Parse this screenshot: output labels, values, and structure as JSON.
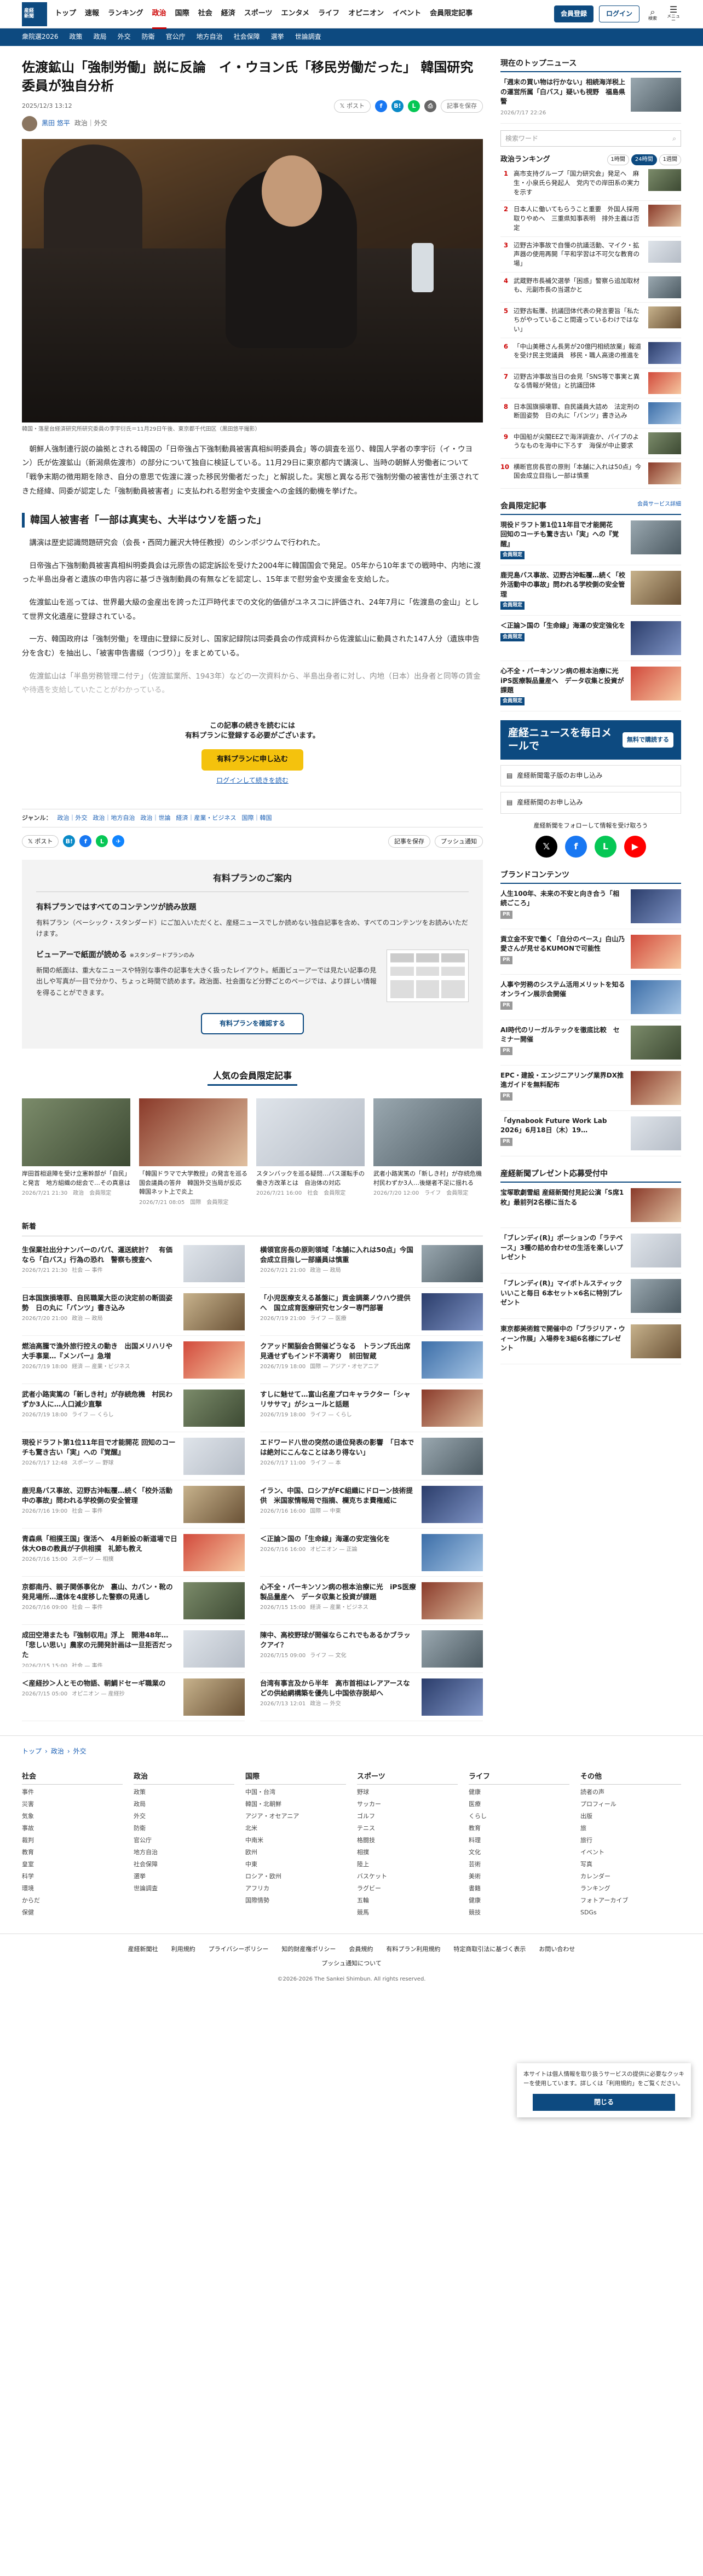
{
  "logo": {
    "line1": "産経",
    "line2": "新聞",
    "en": "THE SANKEI SHIMBUN"
  },
  "gnav": [
    "トップ",
    "速報",
    "ランキング",
    "政治",
    "国際",
    "社会",
    "経済",
    "スポーツ",
    "エンタメ",
    "ライフ",
    "オピニオン",
    "イベント",
    "会員限定記事"
  ],
  "gnav_current": "政治",
  "header": {
    "member": "会員登録",
    "login": "ログイン",
    "search": "検索",
    "menu": "メニュー"
  },
  "subnav": [
    "衆院選2026",
    "政策",
    "政局",
    "外交",
    "防衛",
    "官公庁",
    "地方自治",
    "社会保障",
    "選挙",
    "世論調査"
  ],
  "article": {
    "title": "佐渡鉱山「強制労働」説に反論　イ・ウヨン氏「移民労働だった」 韓国研究委員が独自分析",
    "date": "2025/12/3 13:12",
    "author": "黒田 悠平",
    "section": "政治｜外交",
    "share": {
      "post": "ポスト",
      "bookmark": "記事を保存",
      "print": "印刷"
    },
    "caption": "韓国・落星台経済研究所研究委員の李宇衍氏＝11月29日午後、東京都千代田区（黒田悠平撮影）",
    "p1": "朝鮮人強制連行説の論拠とされる韓国の「日帝強占下強制動員被害真相糾明委員会」等の調査を巡り、韓国人学者の李宇衍（イ・ウヨン）氏が佐渡鉱山（新潟県佐渡市）の部分について独自に検証している。11月29日に東京都内で講演し、当時の朝鮮人労働者について「戦争末期の徴用期を除き、自分の意思で佐渡に渡った移民労働者だった」と解説した。実態と異なる形で強制労働の被害性が主張されてきた経緯、同委が認定した「強制動員被害者」に支払われる慰労金や支援金への金銭的動機を挙げた。",
    "h2": "韓国人被害者「一部は真実も、大半はウソを語った」",
    "p2": "講演は歴史認識問題研究会（会長・西岡力麗沢大特任教授）のシンポジウムで行われた。",
    "p3": "日帝強占下強制動員被害真相糾明委員会は元原告の認定訴訟を受けた2004年に韓国国会で発足。05年から10年までの戦時中、内地に渡った半島出身者と遺族の申告内容に基づき強制動員の有無などを認定し、15年まで慰労金や支援金を支給した。",
    "p4": "佐渡鉱山を巡っては、世界最大級の金産出を誇った江戸時代までの文化的価値がユネスコに評価され、24年7月に「佐渡島の金山」として世界文化遺産に登録されている。",
    "p5": "一方、韓国政府は「強制労働」を理由に登録に反対し、国家記録院は同委員会の作成資料から佐渡鉱山に動員された147人分（遺族申告分を含む）を抽出し、「被害申告書綴（つづり）」をまとめている。",
    "p6": "佐渡鉱山は「半島労務管理ニ付テ」（佐渡鉱業所、1943年）などの一次資料から、半島出身者に対し、内地（日本）出身者と同等の賃金や待遇を支給していたことがわかっている。"
  },
  "paywall": {
    "t1": "この記事の続きを読むには",
    "t2": "有料プランに登録する必要がございます。",
    "btn": "有料プランに申し込む",
    "login": "ログインして続きを読む"
  },
  "tags": {
    "label": "ジャンル：",
    "items": [
      "政治｜外交",
      "政治｜地方自治",
      "政治｜世論",
      "経済｜産業・ビジネス",
      "国際｜韓国"
    ]
  },
  "share2": {
    "post": "ポスト",
    "bookmark": "記事を保存",
    "push": "プッシュ通知"
  },
  "plan": {
    "head": "有料プランのご案内",
    "h1": "有料プランではすべてのコンテンツが読み放題",
    "p1": "有料プラン（ベーシック・スタンダード）にご加入いただくと、産経ニュースでしか読めない独自記事を含め、すべてのコンテンツをお読みいただけます。",
    "h2": "ビューアーで紙面が読める",
    "h2s": "※スタンダードプランのみ",
    "p2": "新聞の紙面は、重大なニュースや特別な事件の記事を大きく扱ったレイアウト。紙面ビューアーでは見たい記事の見出しや写真が一目で分かり、ちょっと時間で読めます。政治面、社会面など分野ごとのページでは、より詳しい情報を得ることができます。",
    "btn": "有料プランを確認する"
  },
  "popular": {
    "title": "人気の会員限定記事",
    "items": [
      {
        "t": "岸田首相退陣を受け立憲幹部が「自民」と発言　地方組織の総会で…その真意は",
        "s": "2026/7/21 21:30　政治　会員限定"
      },
      {
        "t": "「韓国ドラマで大学教授」の発言を巡る国会議員の答弁　韓国外交当局が反応　韓国ネット上で炎上",
        "s": "2026/7/21 08:05　国際　会員限定"
      },
      {
        "t": "スタンバックを巡る疑問…バス運転手の働き方改革とは　自治体の対応",
        "s": "2026/7/21 16:00　社会　会員限定"
      },
      {
        "t": "武者小路実篤の「新しき村」が存続危機　村民わずか3人…後継者不足に揺れる",
        "s": "2026/7/20 12:00　ライフ　会員限定"
      }
    ]
  },
  "news": {
    "title": "新着",
    "items": [
      {
        "t": "生保業社出分ナンバーのパパ、運送統計？　有価なら「白バス」行為の恐れ　警察も捜査へ",
        "d": "2026/7/21 21:30",
        "c": "社会 — 事件"
      },
      {
        "t": "横領官房長の原則領域「本舗に入れは50点」今国会成立目指し一部議員は慎重",
        "d": "2026/7/21 21:00",
        "c": "政治 — 政局"
      },
      {
        "t": "日本国旗損壊罪、自民職業大臣の決定前の断固姿勢　日の丸に「パンツ」書き込み",
        "d": "2026/7/20 21:00",
        "c": "政治 — 政局"
      },
      {
        "t": "「小児医療支える基盤に」貢金調薬ノウハウ提供へ　国立成育医療研究センター専門部署",
        "d": "2026/7/19 21:00",
        "c": "ライフ — 医療"
      },
      {
        "t": "燃油高騰で漁外旅行控えの動き　出国メリハリや大手事業…『メンバー』急増",
        "d": "2026/7/19 18:00",
        "c": "経済 — 産業・ビジネス"
      },
      {
        "t": "クアッド閣脳会合開催どうなる　トランプ氏出席見通せずもインド不満寄り　前田智蔵",
        "d": "2026/7/19 18:00",
        "c": "国際 — アジア・オセアニア"
      },
      {
        "t": "武者小路実篤の「新しき村」が存続危機　村民わずか3人に…人口減少直撃",
        "d": "2026/7/19 18:00",
        "c": "ライフ — くらし"
      },
      {
        "t": "すしに魅せて…富山名産プロキャラクター「シャリササマ」がシュールと話題",
        "d": "2026/7/19 18:00",
        "c": "ライフ — くらし"
      },
      {
        "t": "現役ドラフト第1位11年目で才能開花 回知のコーチも驚き古い「実」への『覚醒』",
        "d": "2026/7/17 12:48",
        "c": "スポーツ — 野球"
      },
      {
        "t": "エドワード八世の突然の退位発表の影響　「日本では絶対にこんなことはあり得ない」",
        "d": "2026/7/17 11:00",
        "c": "ライフ — 本"
      },
      {
        "t": "鹿児島バス事故、辺野古沖転覆…続く「校外活動中の事故」問われる学校側の安全管理",
        "d": "2026/7/16 19:00",
        "c": "社会 — 事件"
      },
      {
        "t": "イラン、中国、ロシアがFC組織にドローン技術提供　米国家情報局で指摘、欄克ちま費権威に",
        "d": "2026/7/16 16:00",
        "c": "国際 — 中東"
      },
      {
        "t": "青森県「相撲王国」復活へ　4月新設の新道場で日体大OBの教員が子供相撲　礼節も教え",
        "d": "2026/7/16 15:00",
        "c": "スポーツ — 相撲"
      },
      {
        "t": "＜正論＞国の「生命線」海運の安定強化を",
        "d": "2026/7/16 16:00",
        "c": "オピニオン — 正論"
      },
      {
        "t": "京都南丹、親子関係事化か　裏山、カバン・靴の発見場所…遺体を4度移した警察の見通し",
        "d": "2026/7/16 09:00",
        "c": "社会 — 事件"
      },
      {
        "t": "心不全・パーキンソン病の根本治療に光　iPS医療製品量産へ　データ収集と投資が課題",
        "d": "2026/7/15 15:00",
        "c": "経済 — 産業・ビジネス"
      },
      {
        "t": "成田空港またも『強制収用』浮上　開港48年…「悲しい思い」農家の元開発計画は一旦拒否だった",
        "d": "2026/7/15 15:00",
        "c": "社会 — 事件"
      },
      {
        "t": "陳中、高校野球が開催ならこれでもあるかブラックアイ？",
        "d": "2026/7/15 09:00",
        "c": "ライフ — 文化"
      },
      {
        "t": "＜産経抄＞人とモの物語、朝鯛ドセーギ職業の",
        "d": "2026/7/15 05:00",
        "c": "オピニオン — 産経抄"
      },
      {
        "t": "台湾有事言及から半年　高市首相はレアアースなどの供給網構築を優先し中国依存脱却へ",
        "d": "2026/7/13 12:01",
        "c": "政治 — 外交"
      }
    ]
  },
  "breadcrumb": [
    "トップ",
    "政治",
    "外交"
  ],
  "sitemap": [
    {
      "h": "社会",
      "items": [
        "事件",
        "災害",
        "気象",
        "事故",
        "裁判",
        "教育",
        "皇室",
        "科学",
        "環境",
        "からだ",
        "保健"
      ]
    },
    {
      "h": "政治",
      "items": [
        "政策",
        "政局",
        "外交",
        "防衛",
        "官公庁",
        "地方自治",
        "社会保障",
        "選挙",
        "世論調査"
      ]
    },
    {
      "h": "国際",
      "items": [
        "中国・台湾",
        "韓国・北朝鮮",
        "アジア・オセアニア",
        "北米",
        "中南米",
        "欧州",
        "中東",
        "ロシア・欧州",
        "アフリカ",
        "国際情勢"
      ]
    },
    {
      "h": "スポーツ",
      "items": [
        "野球",
        "サッカー",
        "ゴルフ",
        "テニス",
        "格闘技",
        "相撲",
        "陸上",
        "バスケット",
        "ラグビー",
        "五輪",
        "競馬"
      ]
    },
    {
      "h": "ライフ",
      "items": [
        "健康",
        "医療",
        "くらし",
        "教育",
        "料理",
        "文化",
        "芸術",
        "美術",
        "書籍",
        "健康",
        "競技"
      ]
    },
    {
      "h": "その他",
      "items": [
        "読者の声",
        "プロフィール",
        "出版",
        "旅",
        "旅行",
        "イベント",
        "写真",
        "カレンダー",
        "ランキング",
        "フォトアーカイブ",
        "SDGs"
      ]
    }
  ],
  "footer": [
    "産経新聞社",
    "利用規約",
    "プライバシーポリシー",
    "知的財産権ポリシー",
    "会員規約",
    "有料プラン利用規約",
    "特定商取引法に基づく表示",
    "お問い合わせ"
  ],
  "footer2": "プッシュ通知について",
  "copyright": "©2026-2026 The Sankei Shimbun. All rights reserved.",
  "side": {
    "top_title": "現在のトップニュース",
    "top_item": "「週末の買い物は行かない」相続海洋税上の運営所属「白バス」疑いも視野　福島県警",
    "top_date": "2026/7/17 22:26",
    "search": "検索ワード",
    "rank_title": "政治ランキング",
    "rank_tabs": [
      "1時間",
      "24時間",
      "1週間"
    ],
    "rank": [
      "高市支持グループ「国力研究会」発足へ　麻生・小泉氏ら発起人　党内での岸田系の実力を示す",
      "日本人に働いてもらうこと重要　外国人採用取りやめへ　三重県知事表明　排外主義は否定",
      "辺野古沖事故で自慢の抗議活動、マイク・拡声器の使用再開「平和学習は不可欠な教育の場」",
      "武蔵野市長補欠選挙「困惑」警察ら追加取材も、元副市長の当選かと",
      "辺野古転覆、抗議団体代表の発言要旨「私たちがやっていること間違っているわけではない」",
      "「中山美穂さん長男が20億円相続放棄」報道を受け民主党議員　移民・職人高速の推進を",
      "辺野古沖事故当日の会見「SNS等で事実と異なる情報が発信」と抗議団体",
      "日本国旗損壊罪、自民議員大詰め　法定刑の断固姿勢　日の丸に「パンツ」書き込み",
      "中国船が尖閣EEZで海洋調査か、パイプのようなものを海中に下ろす　海保が中止要求",
      "横断官房長官の原則「本舗に入れは50点」今国会成立目指し一部は慎重"
    ],
    "member_title": "会員限定記事",
    "member_more": "会員サービス詳細",
    "member": [
      {
        "t": "現役ドラフト第1位11年目で才能開花　回知のコーチも驚き古い「実」への『覚醒』",
        "b": "会員限定"
      },
      {
        "t": "鹿児島バス事故、辺野古沖転覆…続く「校外活動中の事故」問われる学校側の安全管理",
        "b": "会員限定"
      },
      {
        "t": "＜正論＞国の「生命線」海運の安定強化を",
        "b": "会員限定"
      },
      {
        "t": "心不全・パーキンソン病の根本治療に光　iPS医療製品量産へ　データ収集と投資が課題",
        "b": "会員限定"
      }
    ],
    "mail": {
      "t": "産経ニュースを毎日メールで",
      "k": "無料で購読する"
    },
    "paper1": "産経新聞電子版のお申し込み",
    "paper2": "産経新聞のお申し込み",
    "follow": "産経新聞をフォローして情報を受け取ろう",
    "brand_title": "ブランドコンテンツ",
    "brand": [
      {
        "t": "人生100年、未来の不安と向き合う「相続ごころ」",
        "b": "PR"
      },
      {
        "t": "貢立金不安で働く「自分のペース」白山乃愛さんが見せるKUMONで可能性",
        "b": "PR"
      },
      {
        "t": "人事や労務のシステム活用メリットを知る オンライン展示会開催",
        "b": "PR"
      },
      {
        "t": "AI時代のリーガルテックを徹底比較　セミナー開催",
        "b": "PR"
      },
      {
        "t": "EPC・建設・エンジニアリング業界DX推進ガイドを無料配布",
        "b": "PR"
      },
      {
        "t": "「dynabook Future Work Lab 2026」6月18日（木）19…",
        "b": "PR"
      }
    ],
    "gift_title": "産経新聞プレゼント応募受付中",
    "gift": [
      "宝塚歌劇雪組 産経新聞付見記公演「S席1枚」最前列2名様に当たる",
      "「ブレンディ(R)」ポーションの「ラテベース」3種の詰め合わせの生活を楽しいプレゼント",
      "「ブレンディ(R)」マイボトルスティック いいこと毎日 6本セット×6名に特別プレゼント",
      "東京都美術館で開催中の「ブラジリア・ウィーン作展」入場券を3組6名様にプレゼント"
    ]
  },
  "cookie": {
    "t": "本サイトは個人情報を取り扱うサービスの提供に必要なクッキーを使用しています。詳しくは「利用規約」をご覧ください。",
    "ok": "閉じる"
  }
}
